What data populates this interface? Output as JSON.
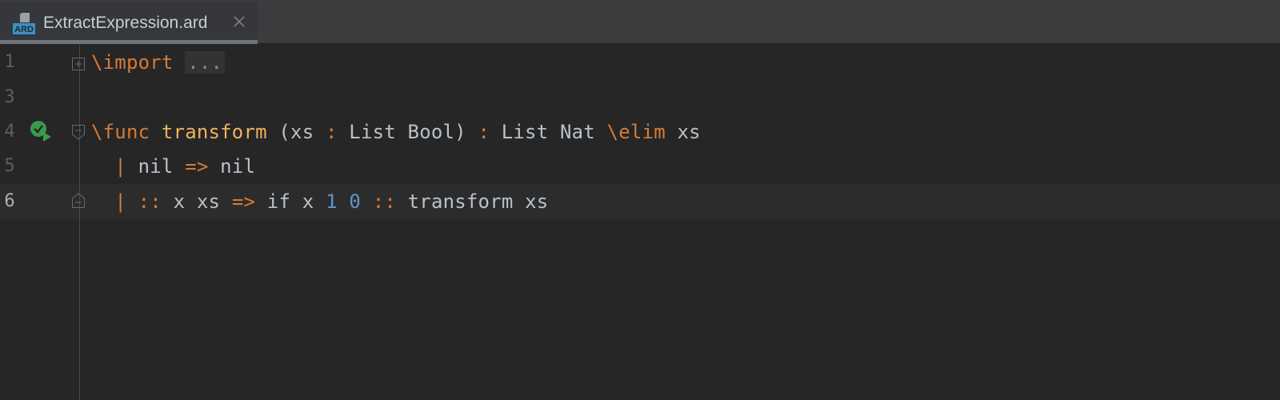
{
  "tab": {
    "icon_label": "ARD",
    "title": "ExtractExpression.ard"
  },
  "lines": [
    {
      "number": "1",
      "tokens": [
        {
          "text": "\\import",
          "cls": "kw"
        },
        {
          "text": " ",
          "cls": ""
        },
        {
          "text": "...",
          "cls": "fold"
        }
      ]
    },
    {
      "number": "3",
      "tokens": []
    },
    {
      "number": "4",
      "tokens": [
        {
          "text": "\\func",
          "cls": "kw"
        },
        {
          "text": " ",
          "cls": ""
        },
        {
          "text": "transform",
          "cls": "fn"
        },
        {
          "text": " (xs ",
          "cls": ""
        },
        {
          "text": ":",
          "cls": "kw"
        },
        {
          "text": " List Bool) ",
          "cls": ""
        },
        {
          "text": ":",
          "cls": "kw"
        },
        {
          "text": " List Nat ",
          "cls": ""
        },
        {
          "text": "\\elim",
          "cls": "kw"
        },
        {
          "text": " xs",
          "cls": ""
        }
      ]
    },
    {
      "number": "5",
      "tokens": [
        {
          "text": "  ",
          "cls": ""
        },
        {
          "text": "|",
          "cls": "kw"
        },
        {
          "text": " nil ",
          "cls": ""
        },
        {
          "text": "=>",
          "cls": "kw"
        },
        {
          "text": " nil",
          "cls": ""
        }
      ]
    },
    {
      "number": "6",
      "tokens": [
        {
          "text": "  ",
          "cls": ""
        },
        {
          "text": "|",
          "cls": "kw"
        },
        {
          "text": " ",
          "cls": ""
        },
        {
          "text": "::",
          "cls": "kw"
        },
        {
          "text": " x xs ",
          "cls": ""
        },
        {
          "text": "=>",
          "cls": "kw"
        },
        {
          "text": " if x ",
          "cls": ""
        },
        {
          "text": "1",
          "cls": "num"
        },
        {
          "text": " ",
          "cls": ""
        },
        {
          "text": "0",
          "cls": "num"
        },
        {
          "text": " ",
          "cls": ""
        },
        {
          "text": "::",
          "cls": "kw"
        },
        {
          "text": " transform xs",
          "cls": ""
        }
      ]
    }
  ],
  "colors": {
    "keyword": "#d47b38",
    "function_name": "#f0b25c",
    "number": "#5d96c8",
    "identifier": "#b9c1ca",
    "background": "#262626"
  },
  "icons": {
    "file": "ard-file-icon",
    "close": "close-icon",
    "run": "run-check-icon",
    "fold": "fold-icon"
  }
}
